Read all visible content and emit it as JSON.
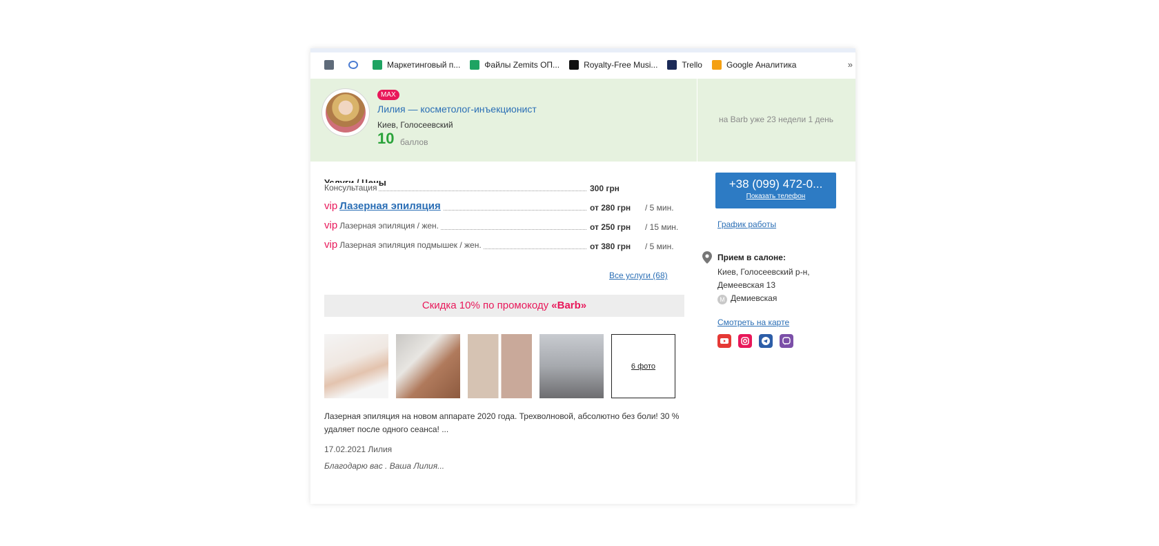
{
  "bookmarks": [
    {
      "label": "",
      "icon": "bookmark-app-icon",
      "color": "#5f6b7a"
    },
    {
      "label": "",
      "icon": "link-icon",
      "color": "#4a7bd1"
    },
    {
      "label": "Маркетинговый п...",
      "icon": "google-sheets-icon",
      "color": "#1ea362"
    },
    {
      "label": "Файлы Zemits ОП...",
      "icon": "google-sheets-icon",
      "color": "#1ea362"
    },
    {
      "label": "Royalty-Free Musi...",
      "icon": "triangle-logo-icon",
      "color": "#111111"
    },
    {
      "label": "Trello",
      "icon": "trello-icon",
      "color": "#1b2a57"
    },
    {
      "label": "Google Аналитика",
      "icon": "analytics-icon",
      "color": "#f4a013"
    }
  ],
  "bookmarks_more": "»",
  "master": {
    "badge": "MAX",
    "name": "Лилия — косметолог-инъекционист",
    "location": "Киев, Голосеевский",
    "score": "10",
    "score_label": "баллов",
    "since": "на Barb уже 23 недели 1 день"
  },
  "services": {
    "title": "Услуги / Цены",
    "items": [
      {
        "vip": "",
        "name": "Консультация",
        "price": "300 грн",
        "duration": ""
      },
      {
        "vip": "vip",
        "name": "Лазерная эпиляция",
        "price": "от 280 грн",
        "duration": "/ 5 мин."
      },
      {
        "vip": "vip",
        "name": "Лазерная эпиляция / жен.",
        "price": "от 250 грн",
        "duration": "/ 15 мин."
      },
      {
        "vip": "vip",
        "name": "Лазерная эпиляция подмышек / жен.",
        "price": "от 380 грн",
        "duration": "/ 5 мин."
      }
    ],
    "all_link": "Все услуги (68)"
  },
  "promo": {
    "text": "Скидка 10% по промокоду ",
    "code": "«Barb»"
  },
  "photos": {
    "more_label": "6 фото"
  },
  "description": "Лазерная эпиляция на новом аппарате 2020 года. Трехволновой, абсолютно без боли! 30 % удаляет после одного сеанса! ...",
  "review": {
    "date_author": "17.02.2021 Лилия",
    "text": "Благодарю вас . Ваша Лилия..."
  },
  "contact": {
    "phone": "+38 (099) 472-0...",
    "show_phone": "Показать телефон",
    "schedule_link": "График работы",
    "salon_label": "Прием в салоне:",
    "address": "Киев, Голосеевский р-н, Демеевская 13",
    "metro_badge": "М",
    "metro": "Демиевская",
    "map_link": "Смотреть на карте"
  },
  "social": [
    "youtube-icon",
    "instagram-icon",
    "telegram-icon",
    "viber-icon"
  ]
}
